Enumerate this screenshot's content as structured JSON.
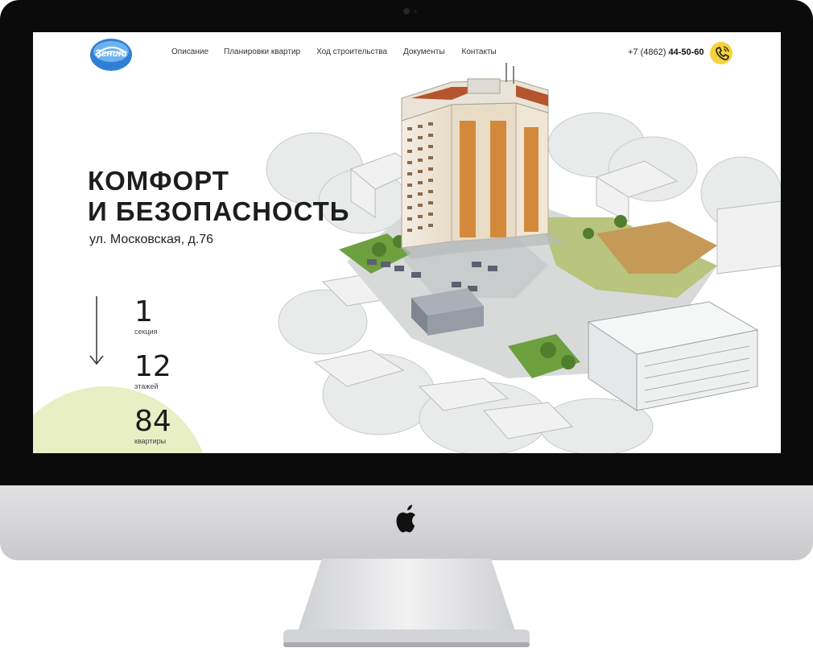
{
  "site": {
    "logo_text": "Зенит",
    "nav": [
      "Описание",
      "Планировки квартир",
      "Ход строительства",
      "Документы",
      "Контакты"
    ],
    "phone_prefix": "+7 (4862) ",
    "phone_main": "44-50-60",
    "headline": [
      "КОМФОРТ",
      "И БЕЗОПАСНОСТЬ"
    ],
    "address": "ул. Московская, д.76",
    "stats": [
      {
        "value": "1",
        "label": "секция"
      },
      {
        "value": "12",
        "label": "этажей"
      },
      {
        "value": "84",
        "label": "квартиры"
      }
    ]
  },
  "colors": {
    "accent_green": "#e8efc4",
    "call_yellow": "#f6d23b",
    "logo_blue": "#2f7fd6"
  }
}
